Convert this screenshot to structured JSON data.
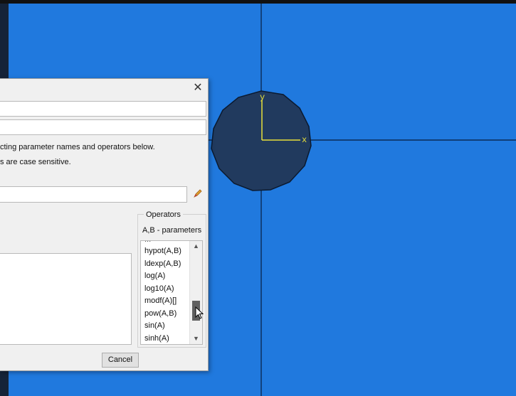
{
  "canvas": {
    "background": "#2079de",
    "grid_color": "#0b2b55",
    "part_fill": "#213a5e",
    "axis_color": "#e8e03a",
    "axis_labels": {
      "y": "y",
      "x": "x"
    }
  },
  "dialog": {
    "close_glyph": "✕",
    "hint_line1": "cting parameter names and operators below.",
    "hint_line2": "s are case sensitive.",
    "operators": {
      "group_title": "Operators",
      "subtitle": "A,B - parameters",
      "items": [
        "hypot(A,B)",
        "ldexp(A,B)",
        "log(A)",
        "log10(A)",
        "modf(A)[]",
        "pow(A,B)",
        "sin(A)",
        "sinh(A)"
      ]
    },
    "cancel_label": "Cancel"
  }
}
